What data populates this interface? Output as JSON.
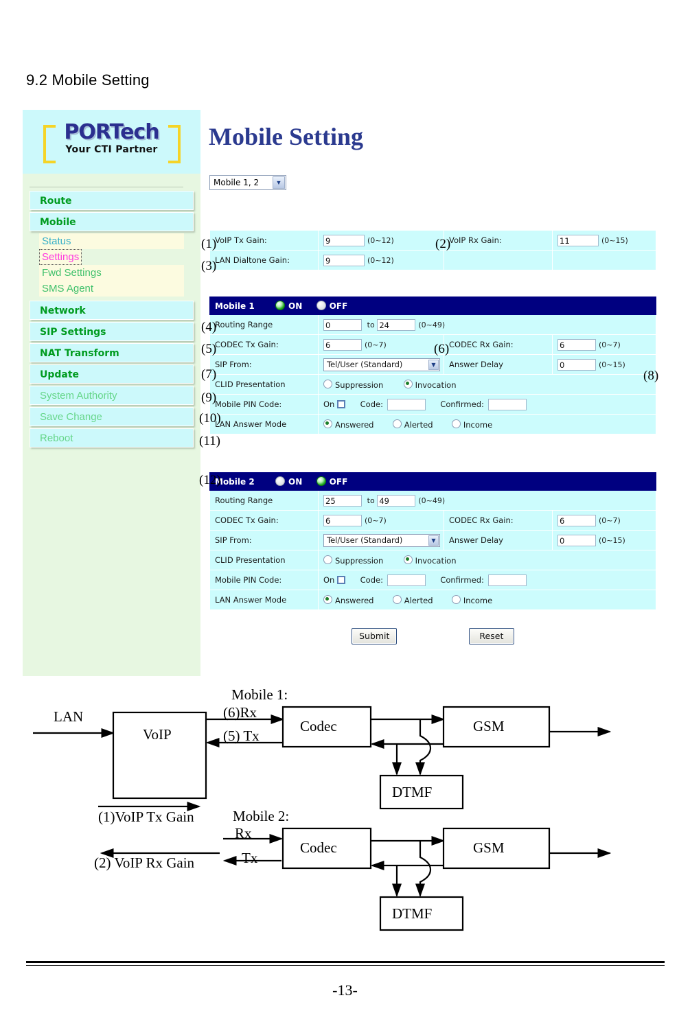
{
  "document": {
    "section_heading": "9.2 Mobile Setting",
    "page_number": "-13-"
  },
  "sidebar": {
    "logo": {
      "main": "PORTech",
      "tagline": "Your CTI Partner"
    },
    "items": [
      {
        "label": "Route",
        "style": "bold"
      },
      {
        "label": "Mobile",
        "style": "bold"
      },
      {
        "label": "Status",
        "style": "sub-teal"
      },
      {
        "label": "Settings",
        "style": "sub-active"
      },
      {
        "label": "Fwd Settings",
        "style": "sub"
      },
      {
        "label": "SMS Agent",
        "style": "sub"
      },
      {
        "label": "Network",
        "style": "bold"
      },
      {
        "label": "SIP Settings",
        "style": "bold"
      },
      {
        "label": "NAT Transform",
        "style": "bold"
      },
      {
        "label": "Update",
        "style": "bold"
      },
      {
        "label": "System Authority",
        "style": "light"
      },
      {
        "label": "Save Change",
        "style": "light"
      },
      {
        "label": "Reboot",
        "style": "light"
      }
    ]
  },
  "main": {
    "page_title": "Mobile Setting",
    "mobile_select": {
      "value": "Mobile 1, 2",
      "arrow": "chevron-down-icon"
    },
    "gain_table": {
      "voip_tx_label": "VoIP Tx Gain:",
      "voip_tx_value": "9",
      "voip_tx_range": "(0~12)",
      "voip_rx_label": "VoIP Rx Gain:",
      "voip_rx_value": "11",
      "voip_rx_range": "(0~15)",
      "lan_dialtone_label": "LAN Dialtone Gain:",
      "lan_dialtone_value": "9",
      "lan_dialtone_range": "(0~12)"
    },
    "mobile1": {
      "title": "Mobile 1",
      "on_label": "ON",
      "off_label": "OFF",
      "power_state": "ON",
      "routing_label": "Routing Range",
      "routing_from": "0",
      "routing_to_word": "to",
      "routing_to": "24",
      "routing_range": "(0~49)",
      "codec_tx_label": "CODEC Tx Gain:",
      "codec_tx_value": "6",
      "codec_tx_range": "(0~7)",
      "codec_rx_label": "CODEC Rx Gain:",
      "codec_rx_value": "6",
      "codec_rx_range": "(0~7)",
      "sip_from_label": "SIP From:",
      "sip_from_value": "Tel/User (Standard)",
      "answer_delay_label": "Answer Delay",
      "answer_delay_value": "0",
      "answer_delay_range": "(0~15)",
      "clid_label": "CLID Presentation",
      "clid_suppression": "Suppression",
      "clid_invocation": "Invocation",
      "clid_selected": "Invocation",
      "pin_label": "Mobile PIN Code:",
      "pin_on_label": "On",
      "pin_code_label": "Code:",
      "pin_code_value": "",
      "pin_confirm_label": "Confirmed:",
      "pin_confirm_value": "",
      "lan_answer_label": "LAN Answer Mode",
      "lan_answered": "Answered",
      "lan_alerted": "Alerted",
      "lan_income": "Income",
      "lan_selected": "Answered"
    },
    "mobile2": {
      "title": "Mobile 2",
      "on_label": "ON",
      "off_label": "OFF",
      "power_state": "OFF",
      "routing_label": "Routing Range",
      "routing_from": "25",
      "routing_to_word": "to",
      "routing_to": "49",
      "routing_range": "(0~49)",
      "codec_tx_label": "CODEC Tx Gain:",
      "codec_tx_value": "6",
      "codec_tx_range": "(0~7)",
      "codec_rx_label": "CODEC Rx Gain:",
      "codec_rx_value": "6",
      "codec_rx_range": "(0~7)",
      "sip_from_label": "SIP From:",
      "sip_from_value": "Tel/User (Standard)",
      "answer_delay_label": "Answer Delay",
      "answer_delay_value": "0",
      "answer_delay_range": "(0~15)",
      "clid_label": "CLID Presentation",
      "clid_suppression": "Suppression",
      "clid_invocation": "Invocation",
      "clid_selected": "Invocation",
      "pin_label": "Mobile PIN Code:",
      "pin_on_label": "On",
      "pin_code_label": "Code:",
      "pin_code_value": "",
      "pin_confirm_label": "Confirmed:",
      "pin_confirm_value": "",
      "lan_answer_label": "LAN Answer Mode",
      "lan_answered": "Answered",
      "lan_alerted": "Alerted",
      "lan_income": "Income",
      "lan_selected": "Answered"
    },
    "submit_label": "Submit",
    "reset_label": "Reset"
  },
  "callouts": {
    "c1": "(1)",
    "c2": "(2)",
    "c3": "(3)",
    "c4": "(4)",
    "c5": "(5)",
    "c6": "(6)",
    "c7": "(7)",
    "c8": "(8)",
    "c9": "(9)",
    "c10": "(10)",
    "c11": "(11)",
    "c12": "(12)"
  },
  "diagram": {
    "lan_label": "LAN",
    "voip_box": "VoIP",
    "mobile1_title": "Mobile 1:",
    "mobile2_title": "Mobile 2:",
    "m1_rx_label": "(6)Rx",
    "m1_tx_label": "(5) Tx",
    "m2_rx_label": "Rx",
    "m2_tx_label": "Tx",
    "codec_box": "Codec",
    "gsm_box": "GSM",
    "dtmf_box": "DTMF",
    "voip_tx_gain_label": "(1)VoIP Tx Gain",
    "voip_rx_gain_label": "(2) VoIP Rx Gain"
  },
  "colors": {
    "panel_green": "#e7f7e1",
    "menu_cyan": "#ccf9fb",
    "row_cyan": "#ccfcfd",
    "header_navy": "#000080",
    "menu_green_text": "#009b1f",
    "active_pink": "#ff38e0",
    "logo_blue": "#2b3a8f",
    "logo_yellow": "#f5d427"
  }
}
